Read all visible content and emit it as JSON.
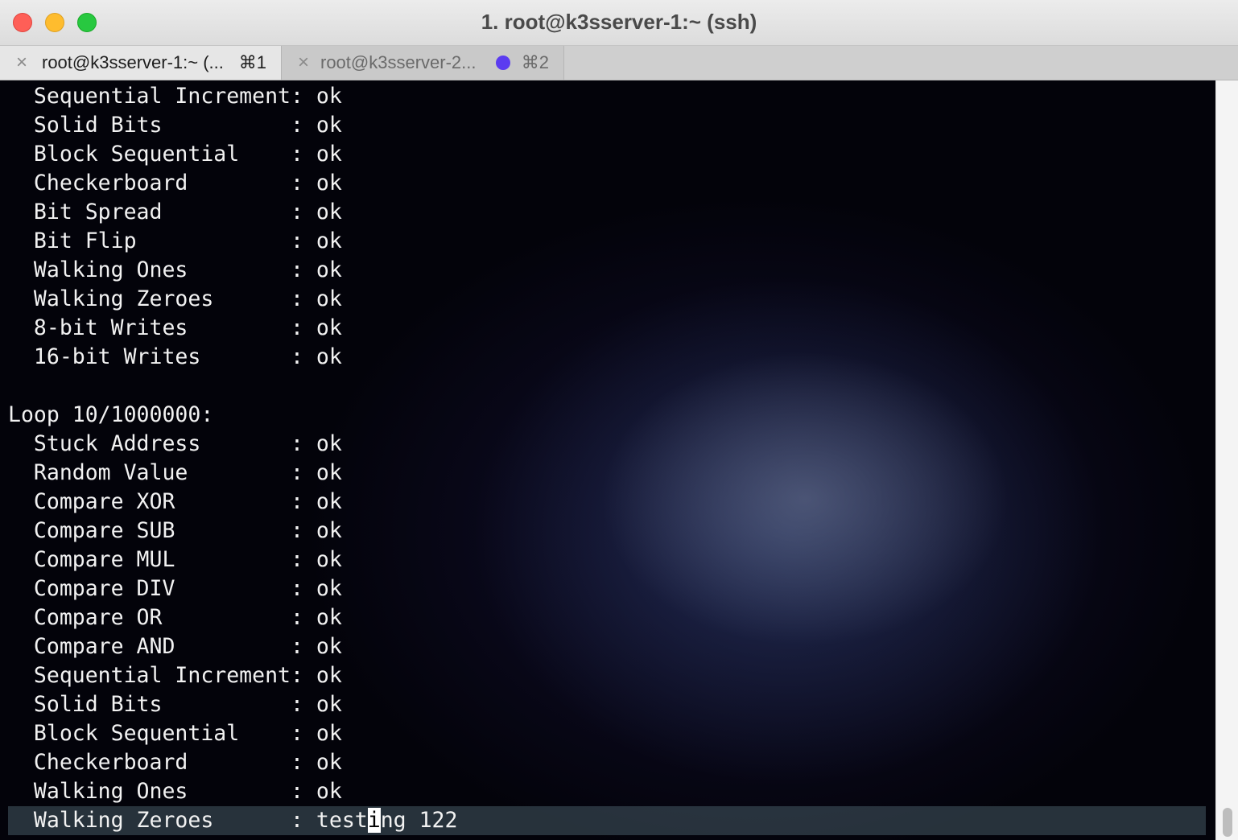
{
  "window": {
    "title": "1. root@k3sserver-1:~ (ssh)"
  },
  "tabs": [
    {
      "label": "root@k3sserver-1:~ (...",
      "shortcut": "⌘1",
      "close_glyph": "×",
      "active": true
    },
    {
      "label": "root@k3sserver-2...",
      "shortcut": "⌘2",
      "close_glyph": "×",
      "active": false,
      "activity_dot_color": "#5b3cf0"
    }
  ],
  "terminal": {
    "lines": [
      "  Sequential Increment: ok",
      "  Solid Bits          : ok",
      "  Block Sequential    : ok",
      "  Checkerboard        : ok",
      "  Bit Spread          : ok",
      "  Bit Flip            : ok",
      "  Walking Ones        : ok",
      "  Walking Zeroes      : ok",
      "  8-bit Writes        : ok",
      "  16-bit Writes       : ok",
      "",
      "Loop 10/1000000:",
      "  Stuck Address       : ok",
      "  Random Value        : ok",
      "  Compare XOR         : ok",
      "  Compare SUB         : ok",
      "  Compare MUL         : ok",
      "  Compare DIV         : ok",
      "  Compare OR          : ok",
      "  Compare AND         : ok",
      "  Sequential Increment: ok",
      "  Solid Bits          : ok",
      "  Block Sequential    : ok",
      "  Checkerboard        : ok",
      "  Walking Ones        : ok"
    ],
    "current_line": {
      "before_cursor": "  Walking Zeroes      : test",
      "cursor_char": "i",
      "after_cursor": "ng 122"
    }
  },
  "colors": {
    "terminal_text": "#f2f2f2",
    "active_tab_bg": "#e6e6e6",
    "inactive_tab_bg": "#c9c9c9",
    "activity_dot": "#5b3cf0"
  }
}
